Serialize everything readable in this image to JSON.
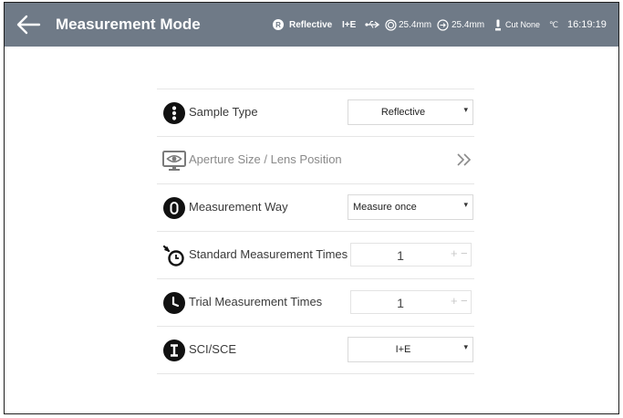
{
  "header": {
    "title": "Measurement Mode",
    "status": {
      "mode": "Reflective",
      "sci_sce": "I+E",
      "aperture": "25.4mm",
      "lens": "25.4mm",
      "uv": "Cut None",
      "temp_unit": "℃",
      "time": "16:19:19"
    },
    "background_color": "#6f7a87"
  },
  "settings": {
    "sample_type": {
      "label": "Sample Type",
      "value": "Reflective"
    },
    "aperture": {
      "label": "Aperture Size / Lens Position"
    },
    "measurement_way": {
      "label": "Measurement Way",
      "value": "Measure once"
    },
    "standard_times": {
      "label": "Standard Measurement Times",
      "value": "1"
    },
    "trial_times": {
      "label": "Trial Measurement Times",
      "value": "1"
    },
    "sci_sce": {
      "label": "SCI/SCE",
      "value": "I+E"
    }
  },
  "glyphs": {
    "caret": "▾",
    "plus": "+",
    "minus": "−"
  },
  "icons": {
    "back": "back-arrow-icon",
    "sample_type": "sample-type-icon",
    "aperture": "eye-monitor-icon",
    "measurement_way": "measure-way-icon",
    "standard_times": "timer-icon",
    "trial_times": "clock-icon",
    "sci_sce": "sci-sce-icon",
    "navigate": "double-chevron-right-icon"
  }
}
